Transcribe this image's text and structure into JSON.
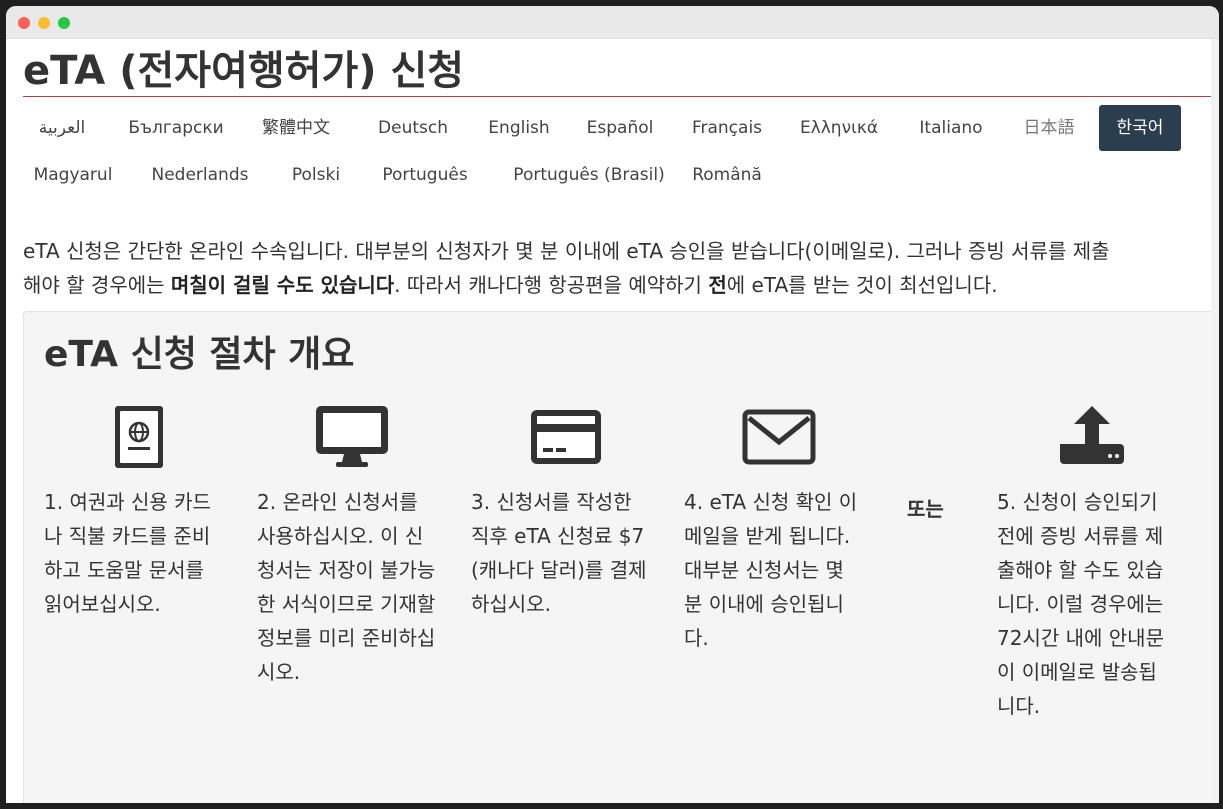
{
  "page": {
    "title": "eTA (전자여행허가) 신청"
  },
  "languages": [
    {
      "label": "العربية"
    },
    {
      "label": "Български"
    },
    {
      "label": "繁體中文"
    },
    {
      "label": "Deutsch"
    },
    {
      "label": "English"
    },
    {
      "label": "Español"
    },
    {
      "label": "Français"
    },
    {
      "label": "Ελληνικά"
    },
    {
      "label": "Italiano"
    },
    {
      "label": "日本語"
    },
    {
      "label": "한국어",
      "active": true
    },
    {
      "label": "Magyarul"
    },
    {
      "label": "Nederlands"
    },
    {
      "label": "Polski"
    },
    {
      "label": "Português"
    },
    {
      "label": "Português (Brasil)"
    },
    {
      "label": "Română"
    }
  ],
  "intro": {
    "part1": "eTA 신청은 간단한 온라인 수속입니다. 대부분의 신청자가 몇 분 이내에 eTA 승인을 받습니다(이메일로). 그러나 증빙 서류를 제출",
    "part2": "해야 할 경우에는 ",
    "bold1": "며칠이 걸릴 수도 있습니다",
    "part3": ". 따라서 캐나다행 항공편을 예약하기 ",
    "bold2": "전",
    "part4": "에 eTA를 받는 것이 최선입니다."
  },
  "overview": {
    "title": "eTA 신청 절차 개요",
    "or_label": "또는",
    "steps": [
      {
        "icon": "passport-icon",
        "text": "1. 여권과 신용 카드나 직불 카드를 준비하고 도움말 문서를 읽어보십시오."
      },
      {
        "icon": "monitor-icon",
        "text": "2. 온라인 신청서를 사용하십시오. 이 신청서는 저장이 불가능한 서식이므로 기재할 정보를 미리 준비하십시오."
      },
      {
        "icon": "credit-card-icon",
        "text": "3. 신청서를 작성한 직후 eTA 신청료 $7(캐나다 달러)를 결제하십시오."
      },
      {
        "icon": "envelope-icon",
        "text": "4. eTA 신청 확인 이메일을 받게 됩니다. 대부분 신청서는 몇 분 이내에 승인됩니다."
      },
      {
        "icon": "upload-icon",
        "text": "5. 신청이 승인되기 전에 증빙 서류를 제출해야 할 수도 있습니다. 이럴 경우에는 72시간 내에 안내문이 이메일로 발송됩니다."
      }
    ]
  },
  "colors": {
    "title_rule": "#a94442",
    "active_tab_bg": "#2b3e50",
    "panel_bg": "#f5f5f5",
    "icon": "#333333"
  }
}
